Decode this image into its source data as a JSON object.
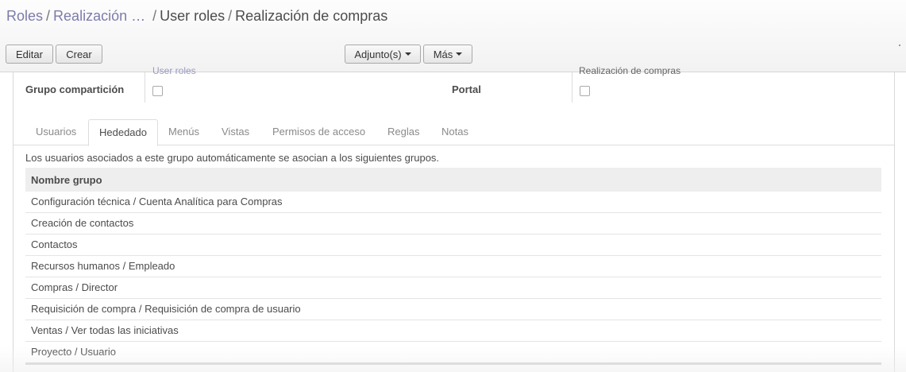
{
  "breadcrumb": [
    {
      "label": "Roles",
      "link": true
    },
    {
      "label": "Realización …",
      "link": true
    },
    {
      "label": "User roles",
      "link": false
    },
    {
      "label": "Realización de compras",
      "link": false
    }
  ],
  "toolbar": {
    "edit_label": "Editar",
    "create_label": "Crear",
    "attachments_label": "Adjunto(s)",
    "more_label": "Más"
  },
  "form": {
    "row_top_left_value": "User roles",
    "row_top_right_value": "Realización de compras",
    "share_group_label": "Grupo compartición",
    "share_group_checked": false,
    "portal_label": "Portal",
    "portal_checked": false
  },
  "tabs": [
    {
      "label": "Usuarios",
      "active": false
    },
    {
      "label": "Hededado",
      "active": true
    },
    {
      "label": "Menús",
      "active": false
    },
    {
      "label": "Vistas",
      "active": false
    },
    {
      "label": "Permisos de acceso",
      "active": false
    },
    {
      "label": "Reglas",
      "active": false
    },
    {
      "label": "Notas",
      "active": false
    }
  ],
  "inherited": {
    "description": "Los usuarios asociados a este grupo automáticamente se asocian a los siguientes grupos.",
    "column_header": "Nombre grupo",
    "rows": [
      "Configuración técnica / Cuenta Analítica para Compras",
      "Creación de contactos",
      "Contactos",
      "Recursos humanos / Empleado",
      "Compras / Director",
      "Requisición de compra / Requisición de compra de usuario",
      "Ventas / Ver todas las iniciativas",
      "Proyecto / Usuario"
    ]
  }
}
